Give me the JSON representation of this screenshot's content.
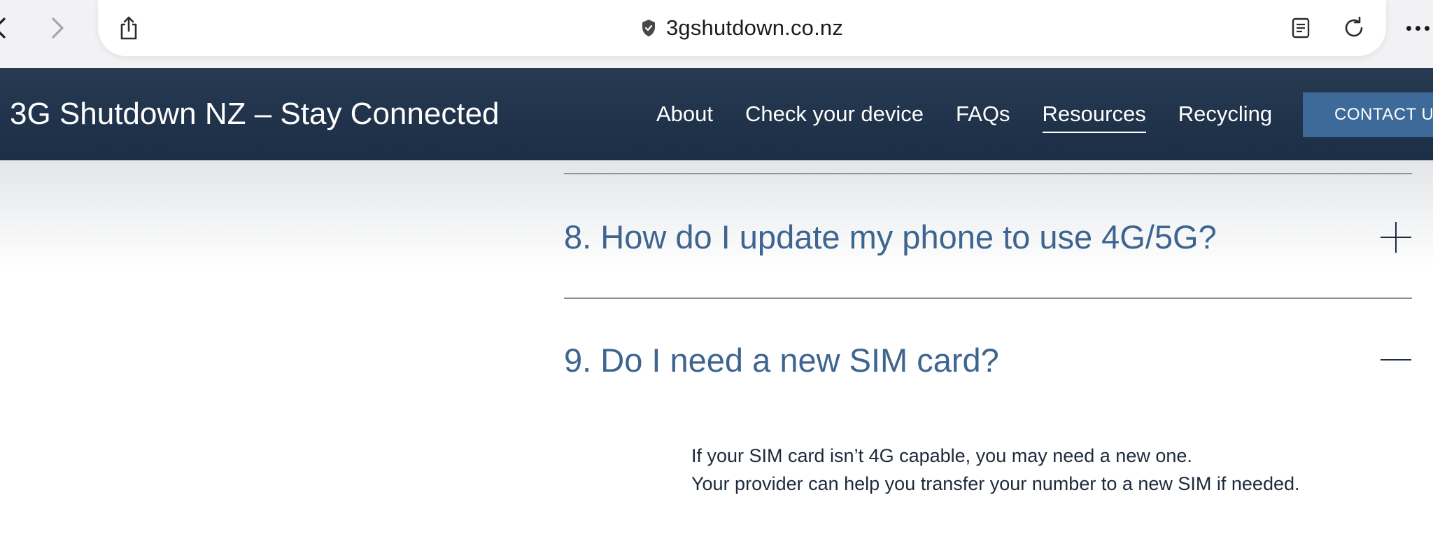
{
  "browser": {
    "url": "3gshutdown.co.nz"
  },
  "header": {
    "site_title": "3G Shutdown NZ – Stay Connected",
    "nav": [
      "About",
      "Check your device",
      "FAQs",
      "Resources",
      "Recycling"
    ],
    "active_nav": "Resources",
    "contact_label": "CONTACT US"
  },
  "faq": {
    "items": [
      {
        "question": "8. How do I update my phone to use 4G/5G?",
        "state": "collapsed",
        "toggle_icon": "plus-icon"
      },
      {
        "question": "9. Do I need a new SIM card?",
        "state": "expanded",
        "toggle_icon": "minus-icon",
        "answer": [
          "If your SIM card isn’t 4G capable, you may need a new one.",
          "Your provider can help you transfer your number to a new SIM if needed."
        ]
      }
    ]
  },
  "colors": {
    "header_bg": "#1e3048",
    "accent": "#3d6a99",
    "question_text": "#3d6590"
  }
}
